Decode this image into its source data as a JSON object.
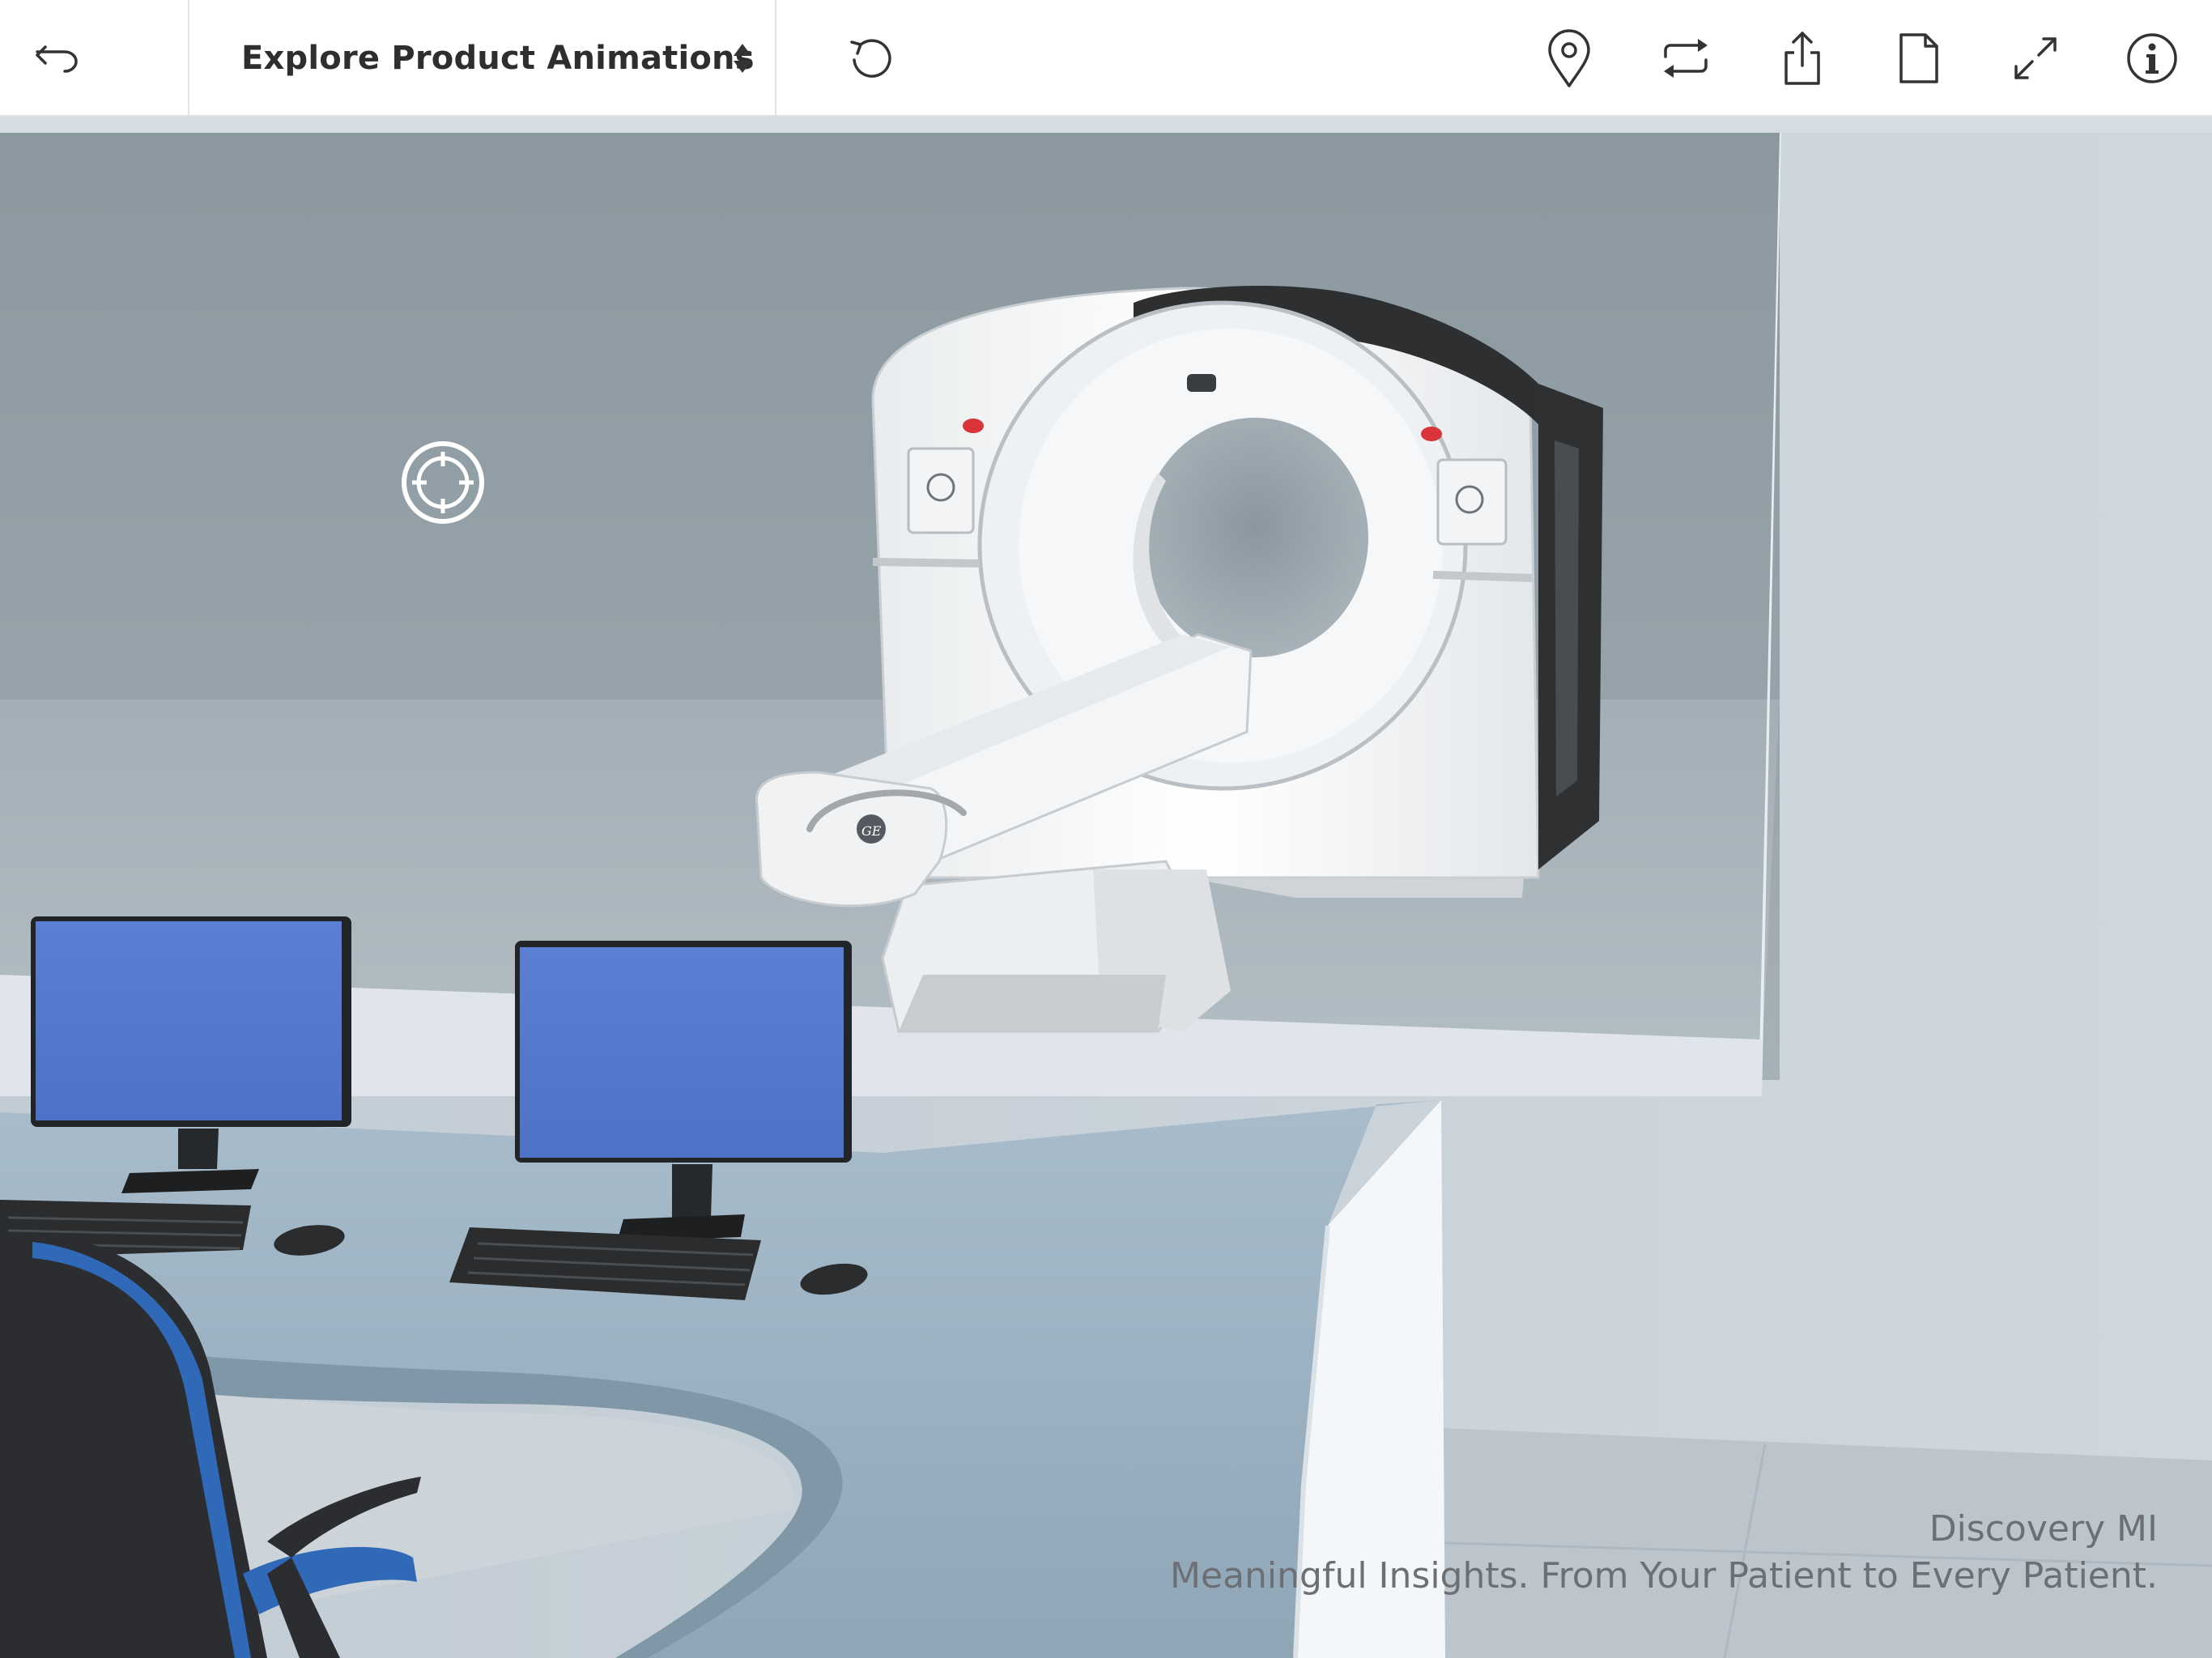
{
  "toolbar": {
    "back_icon": "undo-arrow-icon",
    "dropdown": {
      "selected_label": "Explore Product Animations",
      "caret_icon": "sort-caret-icon"
    },
    "reset_icon": "rotate-ccw-icon",
    "right_icons": [
      "location-pin-icon",
      "swap-rotate-icon",
      "share-icon",
      "document-icon",
      "fullscreen-icon",
      "info-icon"
    ]
  },
  "scene": {
    "hotspot_icon": "target-reticle-icon",
    "colors": {
      "back_wall": "#8e9ba3",
      "floor": "#a9b4bc",
      "room_wall": "#c9d2da",
      "desk": "#9eb3c4",
      "monitor_screen": "#5479cc",
      "chair_accent": "#2f69b7"
    }
  },
  "caption": {
    "title": "Discovery MI",
    "tagline": "Meaningful Insights. From Your Patient to Every Patient."
  }
}
